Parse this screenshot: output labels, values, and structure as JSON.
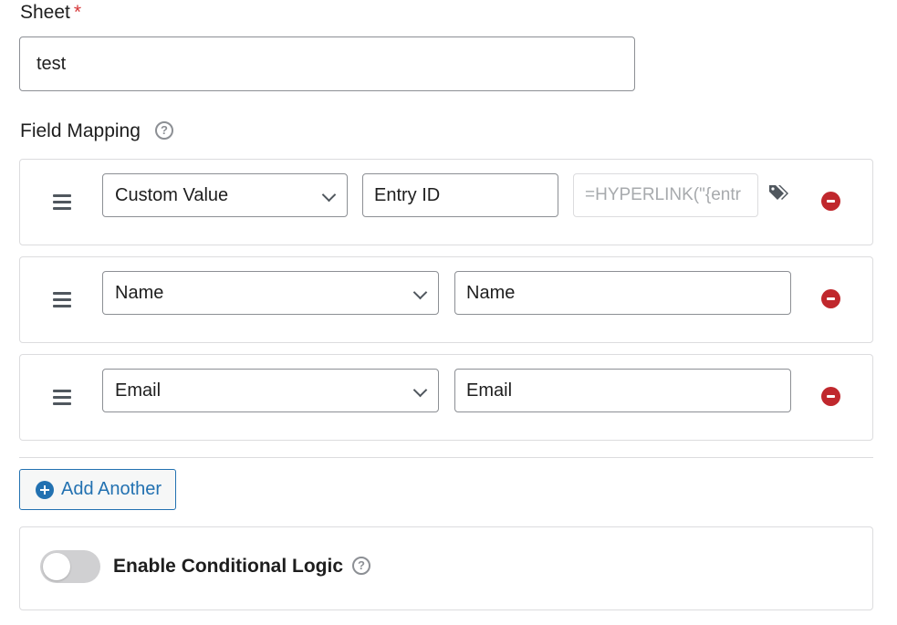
{
  "sheet": {
    "label": "Sheet",
    "required_mark": "*",
    "value": "test"
  },
  "field_mapping": {
    "label": "Field Mapping",
    "rows": [
      {
        "field": "Custom Value",
        "column": "Entry ID",
        "custom_value_placeholder": "=HYPERLINK(\"{entr"
      },
      {
        "field": "Name",
        "column": "Name"
      },
      {
        "field": "Email",
        "column": "Email"
      }
    ]
  },
  "add_another_label": "Add Another",
  "conditional_logic": {
    "label": "Enable Conditional Logic",
    "enabled": false
  },
  "help_icon_glyph": "?"
}
